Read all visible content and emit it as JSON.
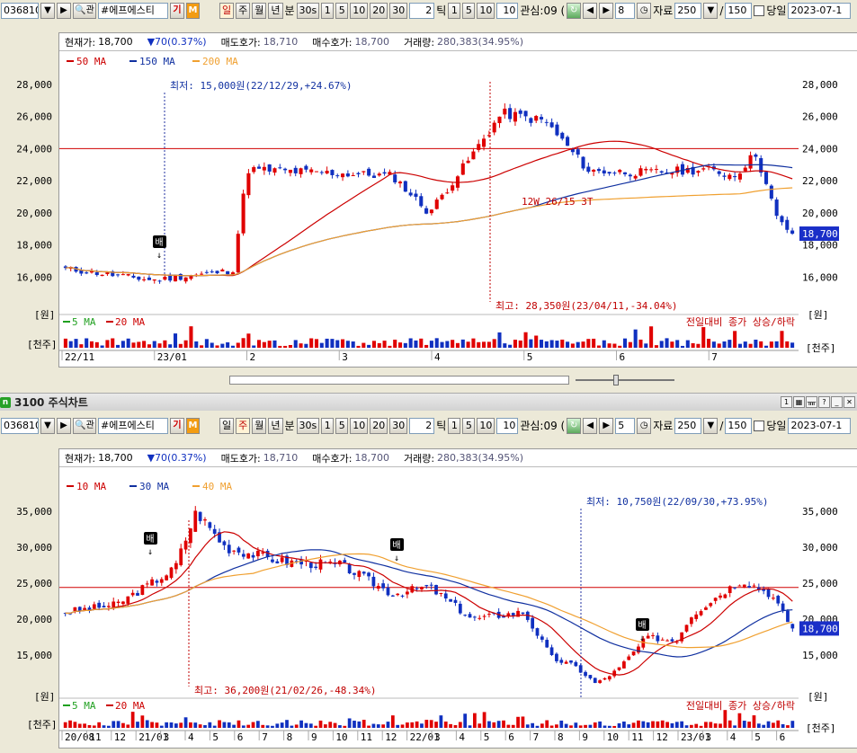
{
  "top_toolbar": {
    "stock_code": "036810",
    "stock_name": "#에프에스티",
    "badge_gi": "기",
    "badge_m": "M",
    "periods": [
      "일",
      "주",
      "월",
      "년",
      "분"
    ],
    "active_period": "일",
    "interval_values": [
      "30s",
      "1",
      "5",
      "10",
      "20",
      "30"
    ],
    "tick_value": "2",
    "tick_label": "틱",
    "tick_values": [
      "1",
      "5",
      "10"
    ],
    "tick_input": "10",
    "watch_label": "관심:09 (",
    "count_value": "8",
    "data_label": "자료",
    "data_count": "250",
    "slash": "/",
    "data_total": "150",
    "day_label": "당일",
    "date": "2023-07-1"
  },
  "window": {
    "title": "3100 주식차트",
    "icon": "n"
  },
  "bottom_toolbar": {
    "stock_code": "036810",
    "stock_name": "#에프에스티",
    "badge_gi": "기",
    "badge_m": "M",
    "periods": [
      "일",
      "주",
      "월",
      "년",
      "분"
    ],
    "active_period": "주",
    "interval_values": [
      "30s",
      "1",
      "5",
      "10",
      "20",
      "30"
    ],
    "tick_value": "2",
    "tick_label": "틱",
    "tick_values": [
      "1",
      "5",
      "10"
    ],
    "tick_input": "10",
    "watch_label": "관심:09 (",
    "count_value": "5",
    "data_label": "자료",
    "data_count": "250",
    "slash": "/",
    "data_total": "150",
    "day_label": "당일",
    "date": "2023-07-1"
  },
  "info_bar": {
    "price_label": "현재가:",
    "price": "18,700",
    "change": "70(0.37%)",
    "ask_label": "매도호가:",
    "ask": "18,710",
    "bid_label": "매수호가:",
    "bid": "18,700",
    "volume_label": "거래량:",
    "volume": "280,383(34.95%)"
  },
  "colors": {
    "up": "#e00000",
    "down": "#1030c0",
    "ma_red": "#cc0000",
    "ma_blue": "#1030a0",
    "ma_orange": "#f0a030",
    "ma_green": "#20a020",
    "price_tag": "#1a2fc8"
  },
  "daily_chart": {
    "legend": [
      {
        "name": "50 MA",
        "color": "#cc0000"
      },
      {
        "name": "150 MA",
        "color": "#1030a0"
      },
      {
        "name": "200 MA",
        "color": "#f0a030"
      }
    ],
    "y_ticks": [
      "28,000",
      "26,000",
      "24,000",
      "22,000",
      "20,000",
      "18,000",
      "16,000"
    ],
    "y_unit": "[원]",
    "current_price_tag": "18,700",
    "low_note": "최저: 15,000원(22/12/29,+24.67%)",
    "high_note": "최고: 28,350원(23/04/11,-34.04%)",
    "pattern_note": "12W 26/15 3T",
    "signal": "배",
    "vol_legend": [
      {
        "name": "5 MA",
        "color": "#20a020"
      },
      {
        "name": "20 MA",
        "color": "#cc0000"
      }
    ],
    "vol_unit": "[천주]",
    "vol_note": "전일대비 종가 상승/하락",
    "x_labels": [
      "22/11",
      "23/01",
      "2",
      "3",
      "4",
      "5",
      "6",
      "7"
    ],
    "chart_data": {
      "type": "candlestick",
      "series": [
        "price"
      ],
      "ylim": [
        14000,
        29000
      ],
      "hlines": [
        24000
      ],
      "low": {
        "value": 15000,
        "date": "22/12/29"
      },
      "high": {
        "value": 28350,
        "date": "23/04/11"
      },
      "last_close": 18700
    }
  },
  "weekly_chart": {
    "legend": [
      {
        "name": "10 MA",
        "color": "#cc0000"
      },
      {
        "name": "30 MA",
        "color": "#1030a0"
      },
      {
        "name": "40 MA",
        "color": "#f0a030"
      }
    ],
    "y_ticks": [
      "35,000",
      "30,000",
      "25,000",
      "20,000",
      "15,000"
    ],
    "y_unit": "[원]",
    "current_price_tag": "18,700",
    "low_note": "최저: 10,750원(22/09/30,+73.95%)",
    "high_note": "최고: 36,200원(21/02/26,-48.34%)",
    "signal": "배",
    "vol_legend": [
      {
        "name": "5 MA",
        "color": "#20a020"
      },
      {
        "name": "20 MA",
        "color": "#cc0000"
      }
    ],
    "vol_unit": "[천주]",
    "vol_note": "전일대비 종가 상승/하락",
    "x_labels": [
      "20/08",
      "11",
      "12",
      "21/01",
      "3",
      "4",
      "5",
      "6",
      "7",
      "8",
      "9",
      "10",
      "11",
      "12",
      "22/01",
      "3",
      "4",
      "5",
      "6",
      "7",
      "8",
      "9",
      "10",
      "11",
      "12",
      "23/01",
      "3",
      "4",
      "5",
      "6"
    ],
    "chart_data": {
      "type": "candlestick",
      "series": [
        "price"
      ],
      "ylim": [
        10000,
        37500
      ],
      "hlines": [
        24400
      ],
      "low": {
        "value": 10750,
        "date": "22/09/30"
      },
      "high": {
        "value": 36200,
        "date": "21/02/26"
      },
      "last_close": 18700
    }
  }
}
